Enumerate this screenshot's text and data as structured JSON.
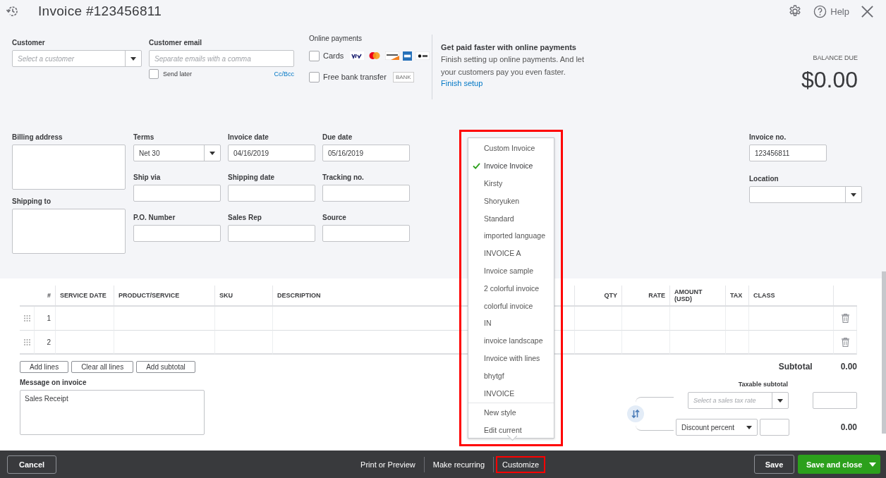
{
  "header": {
    "title": "Invoice #123456811",
    "help": "Help"
  },
  "customer": {
    "label": "Customer",
    "placeholder": "Select a customer"
  },
  "customer_email": {
    "label": "Customer email",
    "placeholder": "Separate emails with a comma",
    "send_later": {
      "label": "Send later",
      "checked": false
    },
    "cc_bcc": "Cc/Bcc"
  },
  "online_payments": {
    "label": "Online payments",
    "options": [
      {
        "label": "Cards",
        "checked": false,
        "kind": "cards"
      },
      {
        "label": "Free bank transfer",
        "checked": false,
        "kind": "bank",
        "badge": "BANK"
      }
    ]
  },
  "promo": {
    "title": "Get paid faster with online payments",
    "text": "Finish setting up online payments. And let your customers pay you even faster.",
    "link": "Finish setup"
  },
  "balance_due": {
    "label": "BALANCE DUE",
    "amount": "$0.00"
  },
  "billing_address": {
    "label": "Billing address"
  },
  "shipping_to": {
    "label": "Shipping to"
  },
  "fields": [
    {
      "label": "Terms",
      "value": "Net 30",
      "kind": "select"
    },
    {
      "label": "Invoice date",
      "value": "04/16/2019",
      "kind": "text"
    },
    {
      "label": "Due date",
      "value": "05/16/2019",
      "kind": "text"
    },
    {
      "label": "Ship via",
      "kind": "text"
    },
    {
      "label": "Shipping date",
      "kind": "text"
    },
    {
      "label": "Tracking no.",
      "kind": "text"
    },
    {
      "label": "P.O. Number",
      "kind": "text"
    },
    {
      "label": "Sales Rep",
      "kind": "text"
    },
    {
      "label": "Source",
      "kind": "text"
    }
  ],
  "invoice_no": {
    "label": "Invoice no.",
    "value": "123456811"
  },
  "location": {
    "label": "Location"
  },
  "table": {
    "columns": [
      "#",
      "SERVICE DATE",
      "PRODUCT/SERVICE",
      "SKU",
      "DESCRIPTION",
      "QTY",
      "RATE",
      "AMOUNT (USD)",
      "TAX",
      "CLASS"
    ],
    "rows": [
      {
        "number": "1"
      },
      {
        "number": "2"
      }
    ]
  },
  "table_buttons": [
    "Add lines",
    "Clear all lines",
    "Add subtotal"
  ],
  "message": {
    "label": "Message on invoice",
    "value": "Sales Receipt"
  },
  "totals": {
    "subtotal_label": "Subtotal",
    "subtotal": "0.00",
    "taxable_subtotal_label": "Taxable subtotal",
    "tax_rate_placeholder": "Select a sales tax rate",
    "discount_type": "Discount percent",
    "discount_total": "0.00"
  },
  "style_menu": {
    "highlighted": true,
    "styles": [
      {
        "label": "Custom Invoice",
        "selected": false
      },
      {
        "label": "Invoice Invoice",
        "selected": true
      },
      {
        "label": "Kirsty",
        "selected": false
      },
      {
        "label": "Shoryuken",
        "selected": false
      },
      {
        "label": "Standard",
        "selected": false
      },
      {
        "label": "imported language",
        "selected": false
      },
      {
        "label": "INVOICE A",
        "selected": false
      },
      {
        "label": "Invoice sample",
        "selected": false
      },
      {
        "label": "2 colorful invoice",
        "selected": false
      },
      {
        "label": "colorful invoice",
        "selected": false
      },
      {
        "label": "IN",
        "selected": false
      },
      {
        "label": "invoice landscape",
        "selected": false
      },
      {
        "label": "Invoice with lines",
        "selected": false
      },
      {
        "label": "bhytgf",
        "selected": false
      },
      {
        "label": "INVOICE",
        "selected": false
      }
    ],
    "actions": [
      "New style",
      "Edit current"
    ]
  },
  "footer": {
    "cancel": "Cancel",
    "links": [
      {
        "label": "Print or Preview",
        "highlighted": false
      },
      {
        "label": "Make recurring",
        "highlighted": false
      },
      {
        "label": "Customize",
        "highlighted": true
      }
    ],
    "save": "Save",
    "save_and_close": "Save and close"
  }
}
